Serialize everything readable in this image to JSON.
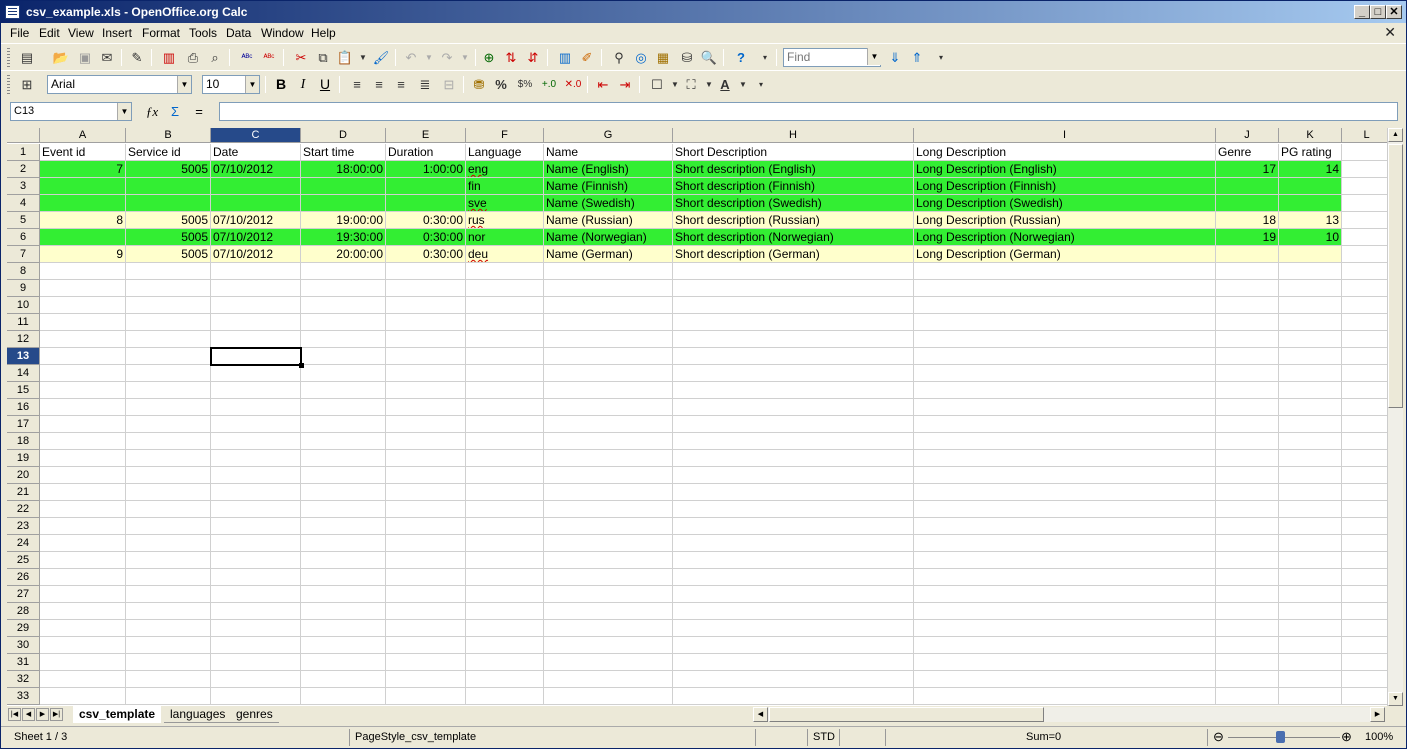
{
  "window": {
    "title": "csv_example.xls - OpenOffice.org Calc",
    "min": "_",
    "max": "□",
    "close": "✕",
    "doc_close": "✕"
  },
  "menu": [
    "File",
    "Edit",
    "View",
    "Insert",
    "Format",
    "Tools",
    "Data",
    "Window",
    "Help"
  ],
  "toolbar": {
    "find_placeholder": "Find",
    "font_name": "Arial",
    "font_size": "10",
    "bold": "B",
    "italic": "I",
    "underline": "U",
    "percent": "%"
  },
  "formula": {
    "cell_ref": "C13",
    "content": ""
  },
  "columns": [
    "A",
    "B",
    "C",
    "D",
    "E",
    "F",
    "G",
    "H",
    "I",
    "J",
    "K",
    "L"
  ],
  "selected_col": "C",
  "rows": [
    "1",
    "2",
    "3",
    "4",
    "5",
    "6",
    "7",
    "8",
    "9",
    "10",
    "11",
    "12",
    "13",
    "14",
    "15",
    "16",
    "17",
    "18",
    "19",
    "20",
    "21",
    "22",
    "23",
    "24",
    "25",
    "26",
    "27",
    "28",
    "29",
    "30",
    "31",
    "32",
    "33"
  ],
  "selected_row": "13",
  "cells": [
    [
      "Event id",
      "Service id",
      "Date",
      "Start time",
      "Duration",
      "Language",
      "Name",
      "Short Description",
      "Long Description",
      "Genre",
      "PG rating"
    ],
    [
      "7",
      "5005",
      "07/10/2012",
      "18:00:00",
      "1:00:00",
      "eng",
      "Name (English)",
      "Short description (English)",
      "Long Description (English)",
      "17",
      "14"
    ],
    [
      "",
      "",
      "",
      "",
      "",
      "fin",
      "Name (Finnish)",
      "Short description (Finnish)",
      "Long Description (Finnish)",
      "",
      ""
    ],
    [
      "",
      "",
      "",
      "",
      "",
      "sve",
      "Name (Swedish)",
      "Short description (Swedish)",
      "Long Description (Swedish)",
      "",
      ""
    ],
    [
      "8",
      "5005",
      "07/10/2012",
      "19:00:00",
      "0:30:00",
      "rus",
      "Name (Russian)",
      "Short description (Russian)",
      "Long Description (Russian)",
      "18",
      "13"
    ],
    [
      "",
      "5005",
      "07/10/2012",
      "19:30:00",
      "0:30:00",
      "nor",
      "Name (Norwegian)",
      "Short description (Norwegian)",
      "Long Description (Norwegian)",
      "19",
      "10"
    ],
    [
      "9",
      "5005",
      "07/10/2012",
      "20:00:00",
      "0:30:00",
      "deu",
      "Name (German)",
      "Short description (German)",
      "Long Description (German)",
      "",
      ""
    ]
  ],
  "row_colors": {
    "green": "#33ee33",
    "yellow": "#ffffcc"
  },
  "sheets": [
    "csv_template",
    "languages",
    "genres"
  ],
  "active_sheet": "csv_template",
  "status": {
    "sheet": "Sheet 1 / 3",
    "page_style": "PageStyle_csv_template",
    "mode": "STD",
    "sum": "Sum=0",
    "zoom": "100%"
  }
}
